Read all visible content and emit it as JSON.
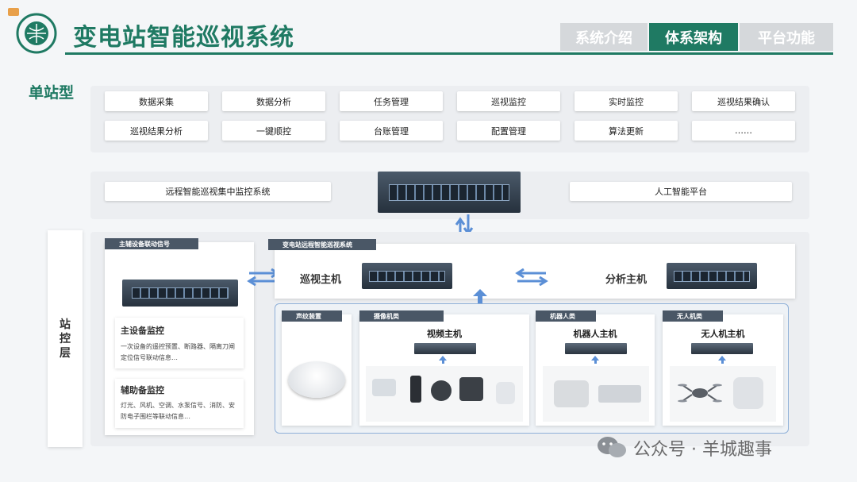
{
  "header": {
    "title": "变电站智能巡视系统",
    "nav": [
      "系统介绍",
      "体系架构",
      "平台功能"
    ],
    "active_index": 1
  },
  "subtitle": "单站型",
  "functions": {
    "row1": [
      "数据采集",
      "数据分析",
      "任务管理",
      "巡视监控",
      "实时监控",
      "巡视结果确认"
    ],
    "row2": [
      "巡视结果分析",
      "一键顺控",
      "台账管理",
      "配置管理",
      "算法更新",
      "……"
    ]
  },
  "central": {
    "left": "远程智能巡视集中监控系统",
    "right": "人工智能平台"
  },
  "station_layer_label": "站控层",
  "linkage": {
    "tag": "主辅设备联动信号",
    "main_title": "主设备监控",
    "main_desc": "一次设备的遥控预置、断路器、隔离刀闸定位信号联动信息…",
    "aux_title": "辅助备监控",
    "aux_desc": "灯光、风机、空调、水泵信号、消防、安防电子围栏等联动信息…"
  },
  "remote_system": {
    "tag": "变电站远程智能巡视系统",
    "patrol_host": "巡视主机",
    "analysis_host": "分析主机"
  },
  "devices": {
    "sound": {
      "tag": "声纹装置"
    },
    "camera": {
      "tag": "摄像机类",
      "host": "视频主机"
    },
    "robot": {
      "tag": "机器人类",
      "host": "机器人主机"
    },
    "drone": {
      "tag": "无人机类",
      "host": "无人机主机"
    }
  },
  "watermark": "公众号 · 羊城趣事",
  "colors": {
    "brand": "#1f7a63",
    "arrow": "#5b8fd6",
    "tag": "#4a5766"
  }
}
